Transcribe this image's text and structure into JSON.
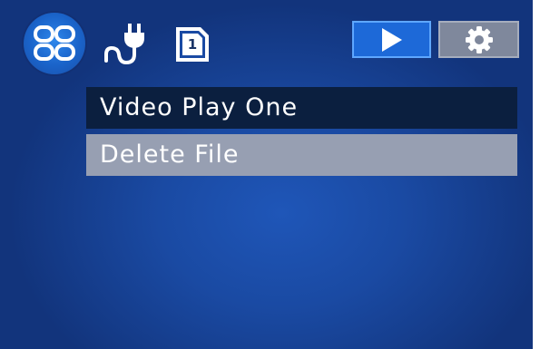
{
  "status_bar": {
    "menu_icon": "grid-menu-icon",
    "power_icon": "power-plug-icon",
    "sd_card_icon": "sd-card-icon",
    "sd_card_slot": "1",
    "tabs": [
      {
        "icon": "play-icon",
        "active": true
      },
      {
        "icon": "gear-icon",
        "active": false
      }
    ]
  },
  "menu": {
    "items": [
      {
        "label": "Video Play One",
        "selected": false
      },
      {
        "label": "Delete File",
        "selected": true
      }
    ]
  },
  "colors": {
    "background": "#1a4aa3",
    "active_tab": "#1d69d8",
    "inactive_tab": "#7f889c",
    "menu_item": "#0b1f3f",
    "menu_item_selected": "#979fb2",
    "text": "#ffffff"
  }
}
